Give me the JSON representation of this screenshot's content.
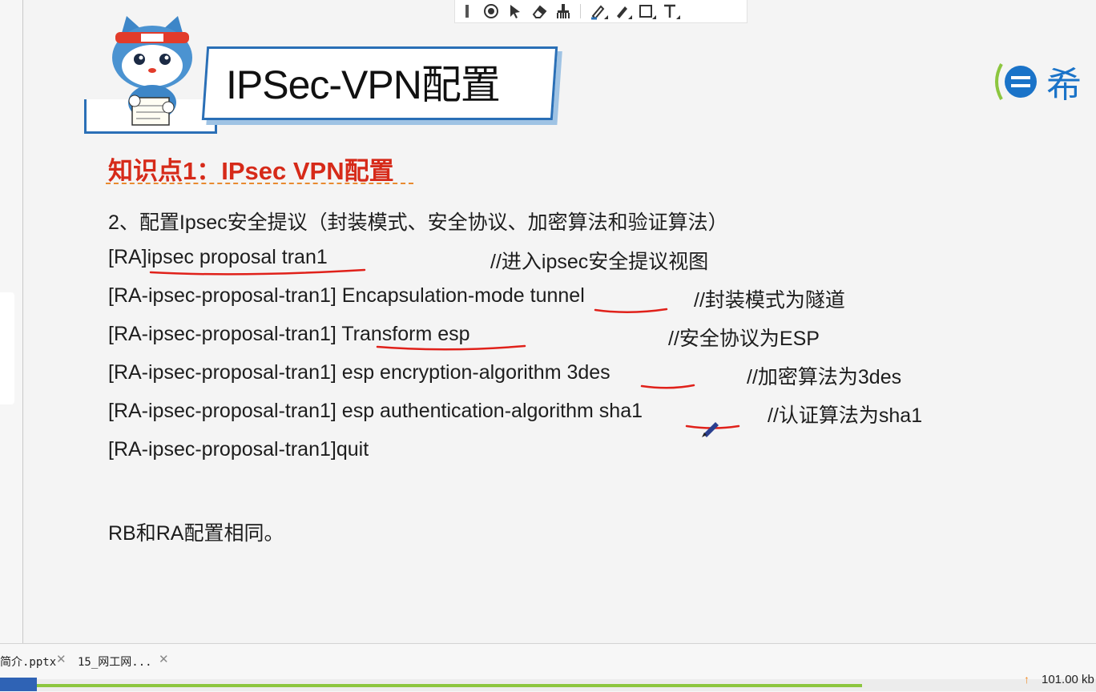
{
  "toolbar": {
    "tools": [
      "laser-pointer",
      "select-arrow",
      "eraser",
      "clear-brush",
      "highlighter",
      "pen",
      "rectangle",
      "text"
    ]
  },
  "slide": {
    "title": "IPSec-VPN配置",
    "brand_text": "希",
    "knowledge_point": "知识点1：IPsec VPN配置",
    "heading": "2、配置Ipsec安全提议（封装模式、安全协议、加密算法和验证算法）",
    "commands": [
      {
        "cmd": "[RA]ipsec proposal tran1",
        "comment": "//进入ipsec安全提议视图"
      },
      {
        "cmd": "[RA-ipsec-proposal-tran1] Encapsulation-mode tunnel",
        "comment": "//封装模式为隧道"
      },
      {
        "cmd": "[RA-ipsec-proposal-tran1] Transform esp",
        "comment": "//安全协议为ESP"
      },
      {
        "cmd": "[RA-ipsec-proposal-tran1] esp encryption-algorithm 3des",
        "comment": "//加密算法为3des"
      },
      {
        "cmd": "[RA-ipsec-proposal-tran1] esp authentication-algorithm sha1",
        "comment": "//认证算法为sha1"
      },
      {
        "cmd": "[RA-ipsec-proposal-tran1]quit",
        "comment": ""
      }
    ],
    "note": "RB和RA配置相同。"
  },
  "taskbar": {
    "tabs": [
      {
        "label": "简介.pptx"
      },
      {
        "label": "15_网工网..."
      }
    ],
    "net_speed": "101.00 kb"
  },
  "colors": {
    "accent_red": "#d62a19",
    "accent_blue": "#2a6fb6",
    "ink_red": "#e0211a"
  }
}
